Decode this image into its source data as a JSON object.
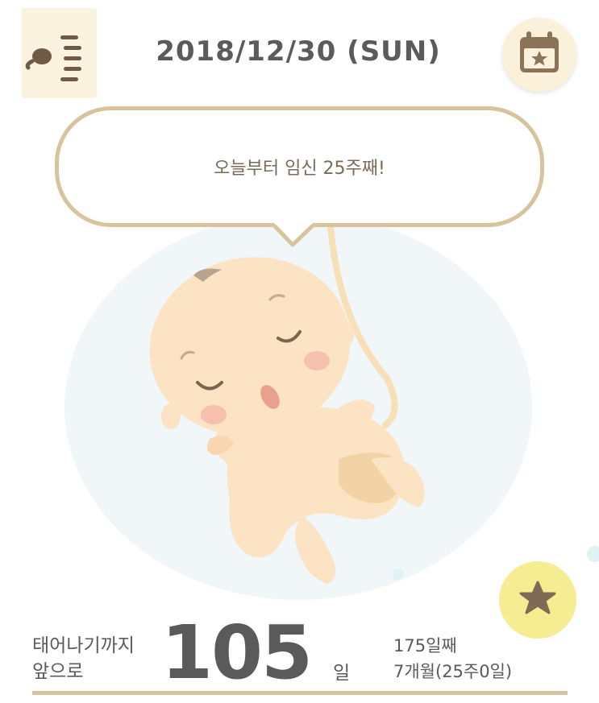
{
  "header": {
    "date": "2018/12/30 (SUN)",
    "menu_icon": "sperm-list-icon",
    "calendar_icon": "calendar-star-icon"
  },
  "bubble": {
    "message": "오늘부터 임신 25주째!"
  },
  "illustration": {
    "name": "sleeping-fetus"
  },
  "favorite": {
    "icon": "star-icon",
    "color": "#f6ed93"
  },
  "countdown": {
    "label_line1": "태어나기까지",
    "label_line2": "앞으로",
    "days": "105",
    "unit": "일"
  },
  "progress": {
    "day_count": "175일째",
    "month_week": "7개월(25주0일)"
  },
  "colors": {
    "accent": "#d7c49d",
    "text": "#5a5a5a",
    "bubble_text": "#7a6a58"
  }
}
